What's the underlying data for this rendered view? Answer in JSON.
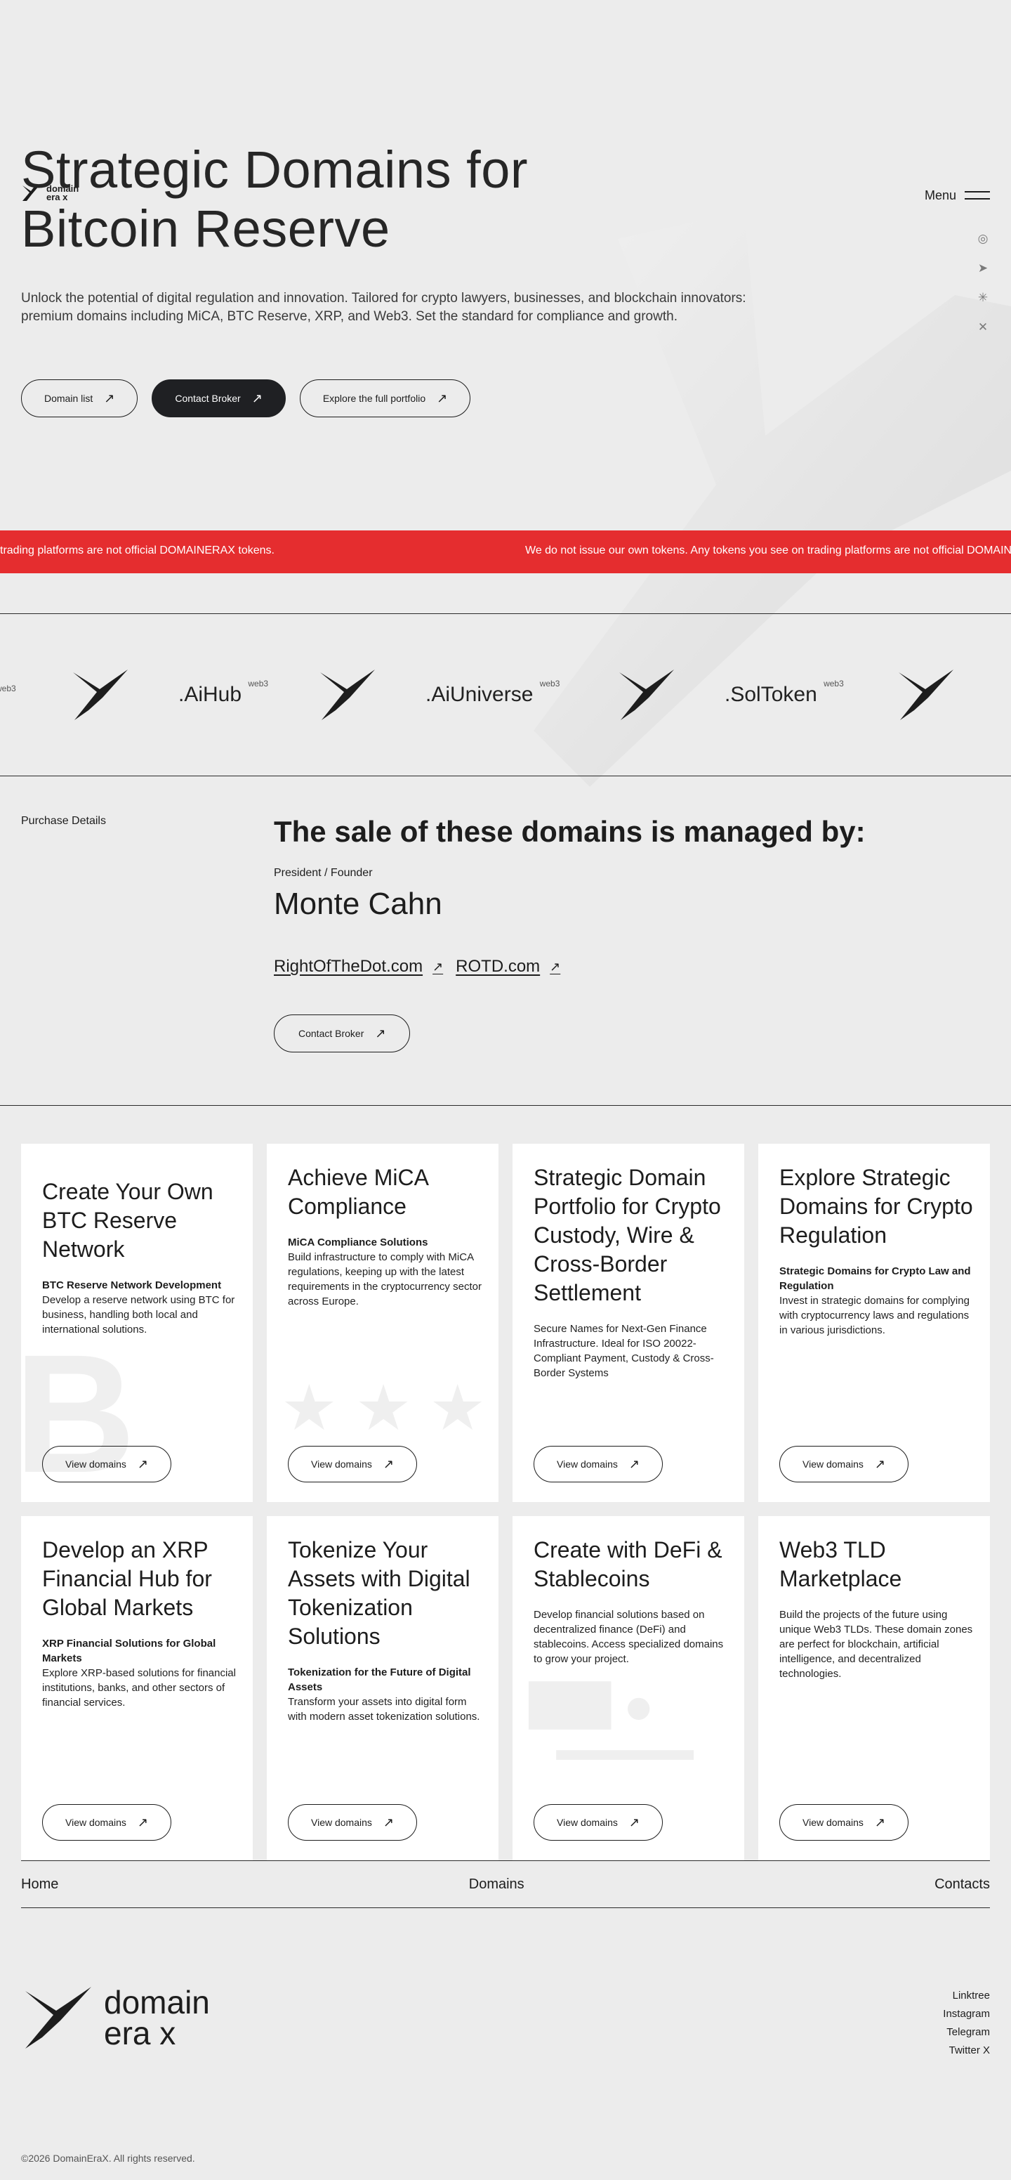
{
  "header": {
    "logo_line1": "domain",
    "logo_line2": "era x",
    "menu_label": "Menu",
    "socials": [
      "instagram-icon",
      "telegram-icon",
      "linktree-icon",
      "x-icon"
    ]
  },
  "hero": {
    "title_line1": "Strategic Domains for",
    "title_line2": "Bitcoin Reserve",
    "description": "Unlock the potential of digital regulation and innovation. Tailored for crypto lawyers, businesses, and blockchain innovators: premium domains including MiCA, BTC Reserve, XRP, and Web3. Set the standard for compliance and growth.",
    "buttons": [
      "Domain list",
      "Contact Broker",
      "Explore the full portfolio"
    ]
  },
  "ticker": {
    "text_1": "trading platforms are not official DOMAINERAX tokens.",
    "text_2": "We do not issue our own tokens. Any tokens you see on trading platforms are not official DOMAINERAX tokens."
  },
  "strip": {
    "tag": "web3",
    "domains": [
      ".AiHub",
      ".AiUniverse",
      ".SolToken"
    ]
  },
  "purchase": {
    "label": "Purchase Details",
    "title": "The sale of these domains is managed by:",
    "role": "President / Founder",
    "name": "Monte Cahn",
    "link_1": "RightOfTheDot.com",
    "link_2": "ROTD.com",
    "button": "Contact Broker"
  },
  "cards": [
    {
      "title": "Create Your Own BTC Reserve Network",
      "subtitle": "BTC Reserve Network Development",
      "desc": "Develop a reserve network using BTC for business, handling both local and international solutions.",
      "button": "View domains"
    },
    {
      "title": "Achieve MiCA Compliance",
      "subtitle": "MiCA Compliance Solutions",
      "desc": "Build infrastructure to comply with MiCA regulations, keeping up with the latest requirements in the cryptocurrency sector across Europe.",
      "button": "View domains"
    },
    {
      "title": "Strategic Domain Portfolio for Crypto Custody, Wire & Cross-Border Settlement",
      "subtitle": "",
      "desc": "Secure Names for Next-Gen Finance Infrastructure. Ideal for ISO 20022-Compliant Payment, Custody & Cross-Border Systems",
      "button": "View domains"
    },
    {
      "title": "Explore Strategic Domains for Crypto Regulation",
      "subtitle": "Strategic Domains for Crypto Law and Regulation",
      "desc": "Invest in strategic domains for complying with cryptocurrency laws and regulations in various jurisdictions.",
      "button": "View domains"
    },
    {
      "title": "Develop an XRP Financial Hub for Global Markets",
      "subtitle": "XRP Financial Solutions for Global Markets",
      "desc": "Explore XRP-based solutions for financial institutions, banks, and other sectors of financial services.",
      "button": "View domains"
    },
    {
      "title": "Tokenize Your Assets with Digital Tokenization Solutions",
      "subtitle": "Tokenization for the Future of Digital Assets",
      "desc": "Transform your assets into digital form with modern asset tokenization solutions.",
      "button": "View domains"
    },
    {
      "title": "Create with DeFi & Stablecoins",
      "subtitle": "",
      "desc": "Develop financial solutions based on decentralized finance (DeFi) and stablecoins. Access specialized domains to grow your project.",
      "button": "View domains"
    },
    {
      "title": "Web3 TLD Marketplace",
      "subtitle": "",
      "desc": "Build the projects of the future using unique Web3 TLDs. These domain zones are perfect for blockchain, artificial intelligence, and decentralized technologies.",
      "button": "View domains"
    }
  ],
  "footer": {
    "nav": [
      "Home",
      "Domains",
      "Contacts"
    ],
    "logo_line1": "domain",
    "logo_line2": "era x",
    "links": [
      "Linktree",
      "Instagram",
      "Telegram",
      "Twitter X"
    ],
    "copyright": "©2026 DomainEraX. All rights reserved."
  },
  "colors": {
    "background": "#ececec",
    "ticker": "#e52d2f",
    "dark_button": "#1f2023"
  }
}
